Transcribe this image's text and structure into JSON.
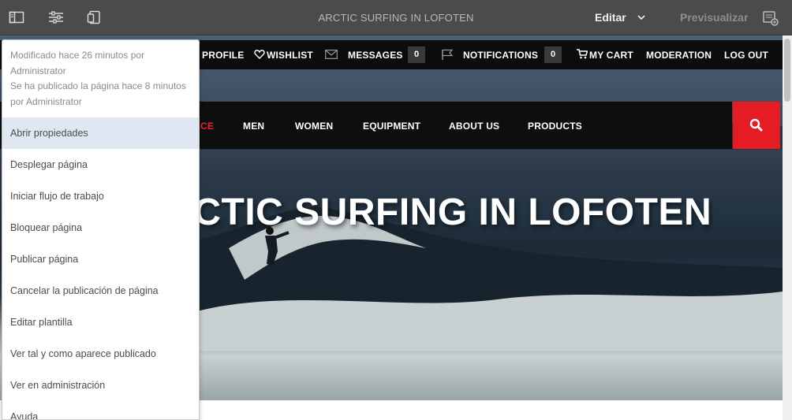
{
  "editor": {
    "title": "ARCTIC SURFING IN LOFOTEN",
    "mode": "Editar",
    "preview": "Previsualizar",
    "colors": {
      "bar": "#4b4b4b",
      "accent": "#e51c23"
    }
  },
  "site": {
    "top_nav": {
      "profile": "PROFILE",
      "wishlist": "WISHLIST",
      "messages": "MESSAGES",
      "messages_count": "0",
      "notifications": "NOTIFICATIONS",
      "notifications_count": "0",
      "cart": "MY CART",
      "moderation": "MODERATION",
      "logout": "LOG OUT"
    },
    "main_nav": {
      "partial_item": "CE",
      "men": "MEN",
      "women": "WOMEN",
      "equipment": "EQUIPMENT",
      "about": "ABOUT US",
      "products": "PRODUCTS"
    },
    "hero_title": "ARCTIC SURFING IN LOFOTEN"
  },
  "popover": {
    "modified": "Modificado hace 26 minutos por Administrator",
    "published": "Se ha publicado la página hace 8 minutos por Administrator",
    "items": [
      "Abrir propiedades",
      "Desplegar página",
      "Iniciar flujo de trabajo",
      "Bloquear página",
      "Publicar página",
      "Cancelar la publicación de página",
      "Editar plantilla",
      "Ver tal y como aparece publicado",
      "Ver en administración",
      "Ayuda"
    ]
  }
}
